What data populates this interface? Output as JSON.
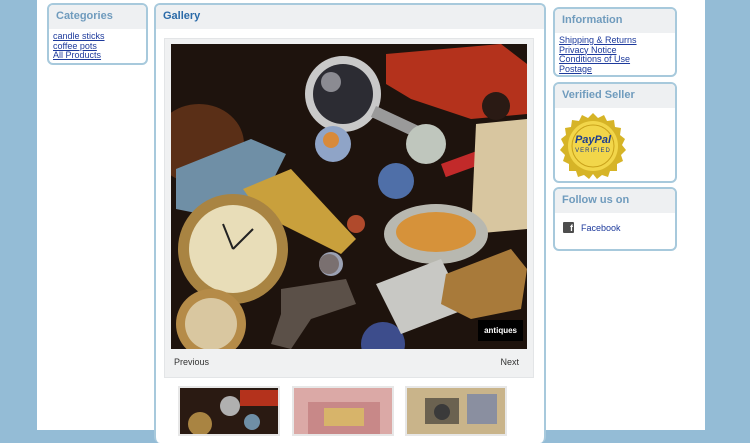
{
  "categories": {
    "title": "Categories",
    "links": [
      "candle sticks",
      "coffee pots",
      "All Products"
    ]
  },
  "gallery": {
    "title": "Gallery",
    "caption": "antiques",
    "previous": "Previous",
    "next": "Next"
  },
  "information": {
    "title": "Information",
    "links": [
      "Shipping & Returns",
      "Privacy Notice",
      "Conditions of Use",
      "Postage"
    ]
  },
  "seller": {
    "title": "Verified Seller",
    "badge_top": "PayPal",
    "badge_bottom": "VERIFIED"
  },
  "follow": {
    "title": "Follow us on",
    "facebook": "Facebook"
  },
  "colors": {
    "background": "#94bcd6",
    "border": "#a7c9dc",
    "header_text": "#6f9bbd",
    "link": "#1d3a9c"
  }
}
